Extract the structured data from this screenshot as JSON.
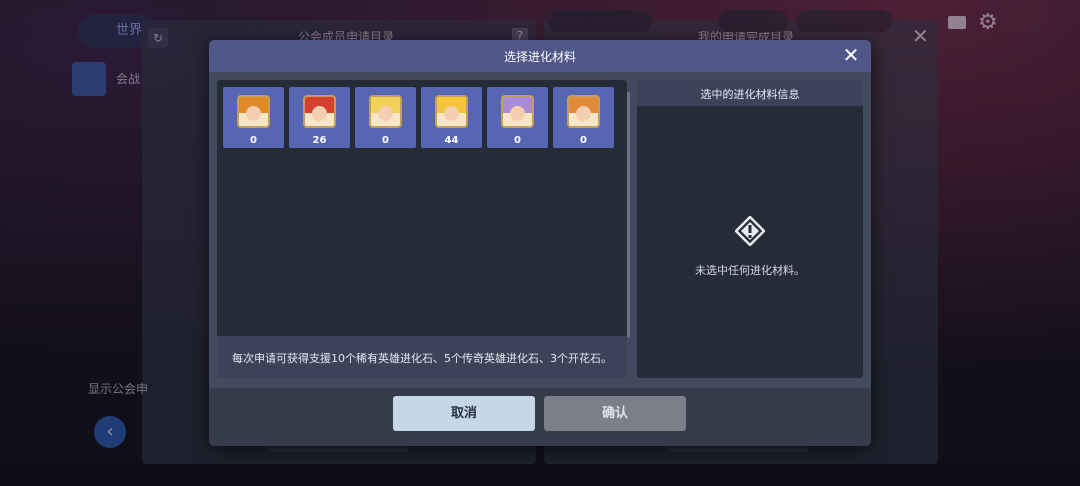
{
  "background": {
    "world_tab": "世界",
    "left_panel_title": "公会成员申请目录",
    "right_panel_title": "我的申请完成目录",
    "speaker_text": "会战",
    "notice_text": "显示公会申",
    "help_label": "?",
    "back_icon": "chevron-left-icon",
    "close_icon": "✕"
  },
  "modal": {
    "title": "选择进化材料",
    "close_label": "✕",
    "items": [
      {
        "count": "0",
        "hair": "#e0892b",
        "frame": "#c3a05a"
      },
      {
        "count": "26",
        "hair": "#d8412f",
        "frame": "#c3a05a"
      },
      {
        "count": "0",
        "hair": "#f2d15a",
        "frame": "#c3a05a"
      },
      {
        "count": "44",
        "hair": "#f4c53a",
        "frame": "#c3a05a"
      },
      {
        "count": "0",
        "hair": "#a98bd6",
        "frame": "#c3a05a"
      },
      {
        "count": "0",
        "hair": "#e08a3a",
        "frame": "#c3a05a"
      }
    ],
    "info_text": "每次申请可获得支援10个稀有英雄进化石、5个传奇英雄进化石、3个开花石。",
    "selected_panel": {
      "title": "选中的进化材料信息",
      "empty_text": "未选中任何进化材料。",
      "icon": "warning-diamond-icon"
    },
    "buttons": {
      "cancel": "取消",
      "confirm": "确认"
    }
  },
  "colors": {
    "header": "#4e5788",
    "item_bg": "#5766b2",
    "cancel_bg": "#c6d8e6",
    "confirm_bg": "#7b7f89"
  }
}
